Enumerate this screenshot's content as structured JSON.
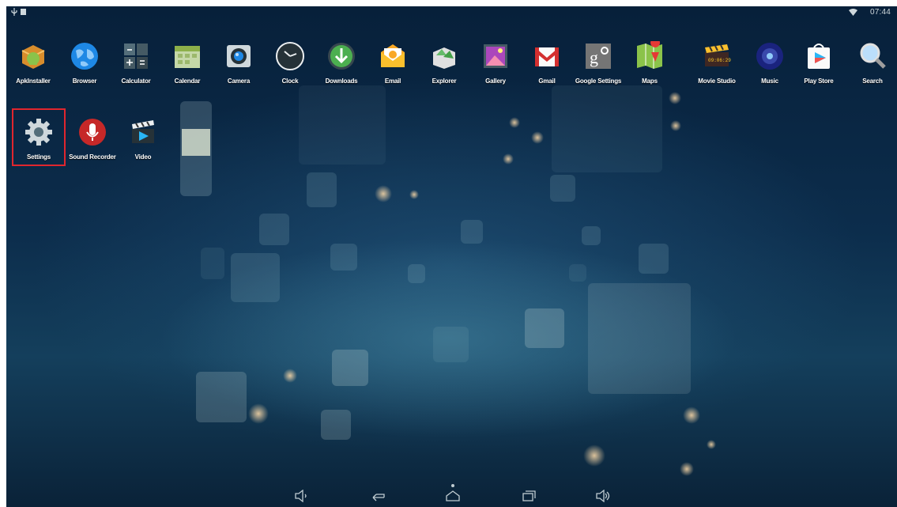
{
  "status_bar": {
    "time": "07:44",
    "icons": [
      "usb-icon",
      "notification-icon",
      "wifi-icon"
    ]
  },
  "apps_row1": [
    {
      "label": "ApkInstaller",
      "icon": "apkinstaller-icon"
    },
    {
      "label": "Browser",
      "icon": "browser-globe-icon"
    },
    {
      "label": "Calculator",
      "icon": "calculator-icon"
    },
    {
      "label": "Calendar",
      "icon": "calendar-icon"
    },
    {
      "label": "Camera",
      "icon": "camera-icon"
    },
    {
      "label": "Clock",
      "icon": "clock-icon"
    },
    {
      "label": "Downloads",
      "icon": "downloads-icon"
    },
    {
      "label": "Email",
      "icon": "email-icon"
    },
    {
      "label": "Explorer",
      "icon": "explorer-icon"
    },
    {
      "label": "Gallery",
      "icon": "gallery-icon"
    },
    {
      "label": "Gmail",
      "icon": "gmail-icon"
    },
    {
      "label": "Google Settings",
      "icon": "google-settings-icon"
    },
    {
      "label": "Maps",
      "icon": "maps-icon"
    },
    {
      "label": "Movie Studio",
      "icon": "movie-studio-icon"
    },
    {
      "label": "Music",
      "icon": "music-icon"
    },
    {
      "label": "Play Store",
      "icon": "play-store-icon"
    },
    {
      "label": "Search",
      "icon": "search-icon"
    }
  ],
  "apps_row2": [
    {
      "label": "Settings",
      "icon": "gear-icon"
    },
    {
      "label": "Sound Recorder",
      "icon": "microphone-icon"
    },
    {
      "label": "Video",
      "icon": "video-clapper-icon"
    }
  ],
  "highlighted_app": "Settings",
  "colors": {
    "highlight": "#e0262e",
    "text": "#ffffff"
  },
  "nav_bar": {
    "icons": [
      "volume-down-icon",
      "back-icon",
      "home-icon",
      "recents-icon",
      "volume-up-icon"
    ]
  }
}
